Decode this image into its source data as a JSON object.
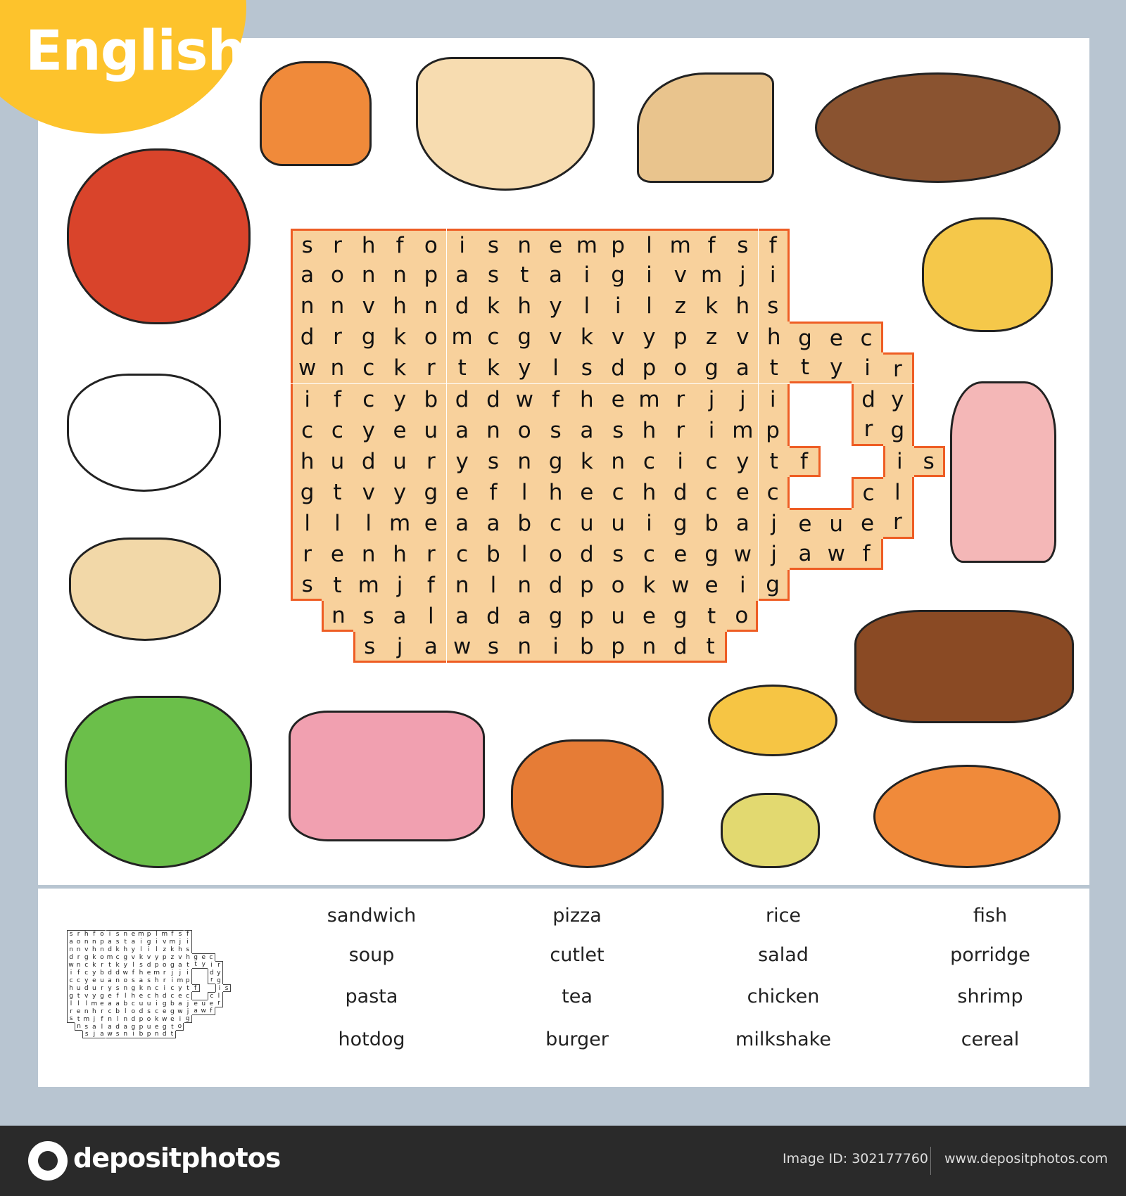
{
  "title": "English",
  "colors": {
    "badge": "#fdc32c",
    "grid_fill": "#f8d19c",
    "grid_border": "#ee5d24",
    "background": "#b8c5d1",
    "footer": "#2a2a2a"
  },
  "grid": {
    "rows": [
      "srhfoisnemplmfsf",
      "aonnpastaigivmji",
      "nnvhndkhylilzkhs",
      "drgkomcgvkvypzvhgec",
      "wnckrtkylsdpogattyir",
      "ifcybddwfhemrjji  dy",
      "ccyeuanosashrimp  rg",
      "hudurysngkncicytf  is",
      "gtvygeflhechdcec  cl",
      "lllmeaabcuuigbajeuer",
      "renhrcblodscegwjawf",
      "stmjfnlndpokweig",
      " nsaladagpuegto",
      "  sjawsnibpndt"
    ]
  },
  "pictures": [
    "burger-icon",
    "pasta-icon",
    "sandwich-icon",
    "cutlet-icon",
    "pizza-icon",
    "tea-icon",
    "rice-icon",
    "milkshake-icon",
    "porridge-icon",
    "chicken-icon",
    "hotdog-icon",
    "salad-icon",
    "shrimp-icon",
    "soup-icon",
    "cereal-icon",
    "fish-icon"
  ],
  "word_columns": [
    [
      "sandwich",
      "soup",
      "pasta",
      "hotdog"
    ],
    [
      "pizza",
      "cutlet",
      "tea",
      "burger"
    ],
    [
      "rice",
      "salad",
      "chicken",
      "milkshake"
    ],
    [
      "fish",
      "porridge",
      "shrimp",
      "cereal"
    ]
  ],
  "footer": {
    "logo": "depositphotos",
    "image_id": "Image ID: 302177760",
    "site": "www.depositphotos.com"
  }
}
